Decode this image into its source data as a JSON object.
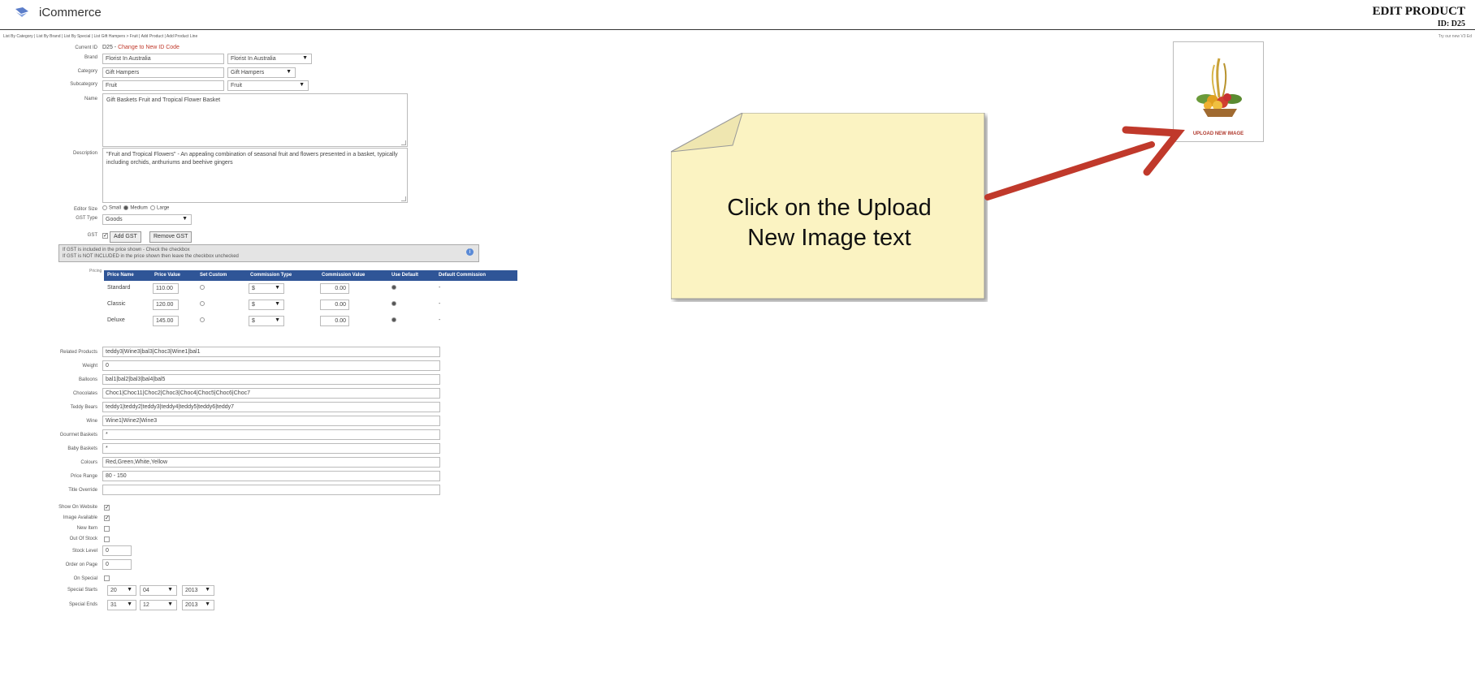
{
  "header": {
    "app_name": "iCommerce",
    "page_title": "EDIT PRODUCT",
    "page_id": "ID: D25",
    "nav_links": "List By Category | List By Brand | List By Special | List Gift Hampers > Fruit | Add Product | Add Product Line",
    "version": "Try our new V3 Ed"
  },
  "form": {
    "current_id_label": "Current ID",
    "current_id_value": "D25 -",
    "change_id_link": "Change to New ID Code",
    "brand_label": "Brand",
    "brand_value": "Florist In Australia",
    "brand_select": "Florist In Australia",
    "category_label": "Category",
    "category_value": "Gift Hampers",
    "category_select": "Gift Hampers",
    "subcategory_label": "Subcategory",
    "subcategory_value": "Fruit",
    "subcategory_select": "Fruit",
    "name_label": "Name",
    "name_value": "Gift Baskets Fruit and Tropical Flower Basket",
    "description_label": "Description",
    "description_value": "\"Fruit and Tropical Flowers\" - An appealing combination of seasonal fruit and flowers presented in a basket, typically including orchids, anthuriums and beehive gingers",
    "editor_size_label": "Editor Size",
    "editor_size_options": [
      "Small",
      "Medium",
      "Large"
    ],
    "gst_type_label": "GST Type",
    "gst_type_value": "Goods",
    "gst_label": "GST",
    "add_gst_button": "Add GST",
    "remove_gst_button": "Remove GST",
    "gst_info_line1": "If GST is included in the price shown - Check the checkbox",
    "gst_info_line2": "If GST is NOT INCLUDED in the price shown then leave the checkbox unchecked",
    "pricing_side_label": "Pricing"
  },
  "pricing": {
    "headers": [
      "Price Name",
      "Price Value",
      "Set Custom",
      "Commission Type",
      "Commission Value",
      "Use Default",
      "Default Commission"
    ],
    "rows": [
      {
        "name": "Standard",
        "value": "110.00",
        "commission_type": "$",
        "commission_value": "0.00",
        "default": "-"
      },
      {
        "name": "Classic",
        "value": "120.00",
        "commission_type": "$",
        "commission_value": "0.00",
        "default": "-"
      },
      {
        "name": "Deluxe",
        "value": "145.00",
        "commission_type": "$",
        "commission_value": "0.00",
        "default": "-"
      }
    ]
  },
  "attributes": [
    {
      "label": "Related Products",
      "value": "teddy3|Wine3|bal3|Choc3|Wine1|bal1"
    },
    {
      "label": "Weight",
      "value": "0"
    },
    {
      "label": "Balloons",
      "value": "bal1|bal2|bal3|bal4|bal5"
    },
    {
      "label": "Chocolates",
      "value": "Choc1|Choc11|Choc2|Choc3|Choc4|Choc5|Choc6|Choc7"
    },
    {
      "label": "Teddy Bears",
      "value": "teddy1|teddy2|teddy3|teddy4|teddy5|teddy6|teddy7"
    },
    {
      "label": "Wine",
      "value": "Wine1|Wine2|Wine3"
    },
    {
      "label": "Gourmet Baskets",
      "value": "*"
    },
    {
      "label": "Baby Baskets",
      "value": "*"
    },
    {
      "label": "Colours",
      "value": "Red,Green,White,Yellow"
    },
    {
      "label": "Price Range",
      "value": "80 - 150"
    },
    {
      "label": "Title Override",
      "value": ""
    }
  ],
  "flags": [
    {
      "label": "Show On Website",
      "checked": true
    },
    {
      "label": "Image Available",
      "checked": true
    },
    {
      "label": "New Item",
      "checked": false
    },
    {
      "label": "Out Of Stock",
      "checked": false
    }
  ],
  "stock": {
    "stock_level_label": "Stock Level",
    "stock_level_value": "0",
    "order_label": "Order on Page",
    "order_value": "0",
    "on_special_label": "On Special",
    "special_starts_label": "Special Starts",
    "special_starts": [
      "20",
      "04",
      "2013"
    ],
    "special_ends_label": "Special Ends",
    "special_ends": [
      "31",
      "12",
      "2013"
    ]
  },
  "image_panel": {
    "upload_link": "UPLOAD NEW IMAGE"
  },
  "callout": {
    "line1": "Click on the Upload",
    "line2": "New Image text",
    "note_color": "#fbf3c2",
    "arrow_color": "#c0392b"
  }
}
